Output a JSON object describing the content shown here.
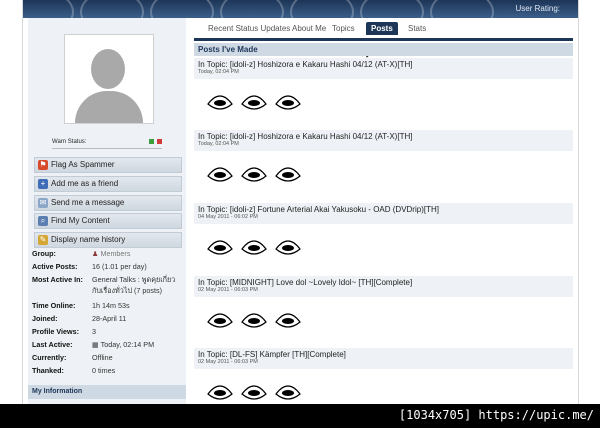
{
  "header": {
    "rating": "User Rating:"
  },
  "profile": {
    "warn_label": "Warn Status:",
    "actions": [
      {
        "label": "Flag As Spammer",
        "icon": "flag-icon",
        "color": "#d84b2a"
      },
      {
        "label": "Add me as a friend",
        "icon": "add-friend-icon",
        "color": "#3f6db8"
      },
      {
        "label": "Send me a message",
        "icon": "envelope-icon",
        "color": "#8aa7c9"
      },
      {
        "label": "Find My Content",
        "icon": "search-icon",
        "color": "#5a7fb0"
      },
      {
        "label": "Display name history",
        "icon": "pencil-icon",
        "color": "#d4a734"
      }
    ],
    "info": [
      {
        "k": "Group:",
        "v": "Members"
      },
      {
        "k": "Active Posts:",
        "v": "16 (1.01 per day)"
      },
      {
        "k": "Most Active In:",
        "v": "General Talks : พูดคุยเกี่ยวกับเรื่องทั่วไป (7 posts)"
      },
      {
        "k": "Time Online:",
        "v": "1h 14m 53s"
      },
      {
        "k": "Joined:",
        "v": "28-April 11"
      },
      {
        "k": "Profile Views:",
        "v": "3"
      },
      {
        "k": "Last Active:",
        "v": "Today, 02:14 PM"
      },
      {
        "k": "Currently:",
        "v": "Offline"
      },
      {
        "k": "Thanked:",
        "v": "0 times"
      }
    ],
    "my_info": "My Information"
  },
  "tabs": [
    {
      "label": "Recent Status Updates"
    },
    {
      "label": "About Me"
    },
    {
      "label": "Topics"
    },
    {
      "label": "Posts"
    },
    {
      "label": "Stats"
    }
  ],
  "posts_header": "Posts I've Made",
  "posts": [
    {
      "title": "In Topic: [idoli-z] Hoshizora e Kakaru Hashi 04/12 (AT-X)[TH]",
      "date": "Today, 02:04 PM"
    },
    {
      "title": "In Topic: [idoli-z] Hoshizora e Kakaru Hashi 04/12 (AT-X)[TH]",
      "date": "Today, 02:04 PM"
    },
    {
      "title": "In Topic: [idoli-z] Fortune Arterial Akai Yakusoku - OAD (DVDrip)[TH]",
      "date": "04 May 2011 - 06:02 PM"
    },
    {
      "title": "In Topic: [MIDNIGHT] Love dol ~Lovely Idol~ [TH][Complete]",
      "date": "02 May 2011 - 06:03 PM"
    },
    {
      "title": "In Topic: [DL-FS] Kämpfer [TH][Complete]",
      "date": "02 May 2011 - 06:03 PM"
    }
  ],
  "watermark": "[1034x705] https://upic.me/"
}
